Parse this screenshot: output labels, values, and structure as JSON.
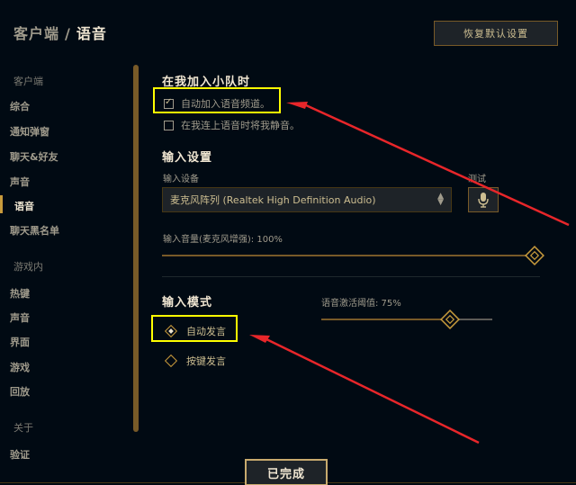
{
  "header": {
    "breadcrumb_parent": "客户端",
    "breadcrumb_sep": "/",
    "breadcrumb_current": "语音",
    "reset_label": "恢复默认设置"
  },
  "sidebar": {
    "client_group": "客户端",
    "client_items": [
      "综合",
      "通知弹窗",
      "聊天&好友",
      "声音",
      "语音",
      "聊天黑名单"
    ],
    "active_item": "语音",
    "ingame_group": "游戏内",
    "ingame_items": [
      "热键",
      "声音",
      "界面",
      "游戏",
      "回放"
    ],
    "about_group": "关于",
    "about_items": [
      "验证"
    ]
  },
  "party": {
    "title": "在我加入小队时",
    "auto_join_label": "自动加入语音频道。",
    "auto_join_checked": true,
    "mute_label": "在我连上语音时将我静音。",
    "mute_checked": false
  },
  "input_settings": {
    "title": "输入设置",
    "device_label": "输入设备",
    "device_value": "麦克风阵列 (Realtek High Definition Audio)",
    "test_label": "测试",
    "volume_label": "输入音量(麦克风增强): 100%",
    "volume_value": 1.0
  },
  "input_mode": {
    "title": "输入模式",
    "threshold_label": "语音激活阈值: 75%",
    "threshold_value": 0.75,
    "options": [
      "自动发言",
      "按键发言"
    ],
    "selected": "自动发言"
  },
  "footer": {
    "done_label": "已完成"
  },
  "colors": {
    "background": "#010a13",
    "gold": "#c89b3c",
    "text_light": "#f0e6d2",
    "text_muted": "#a09b8c",
    "highlight": "#ffff00",
    "annotation_arrow": "#e8262a"
  }
}
